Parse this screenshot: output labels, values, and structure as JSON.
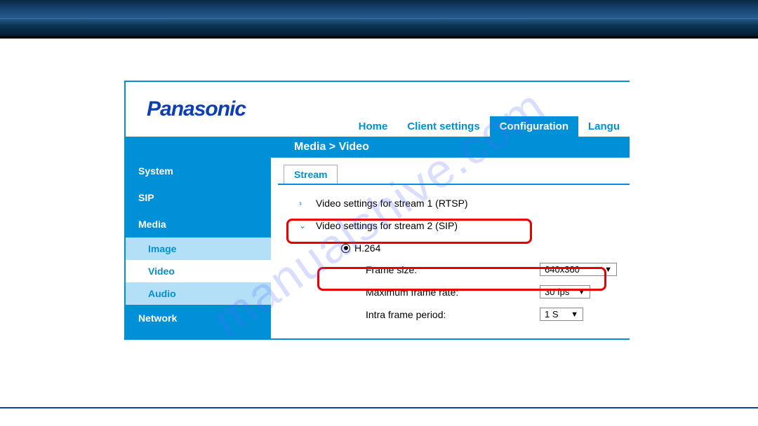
{
  "watermark": "manualshive.com",
  "brand": "Panasonic",
  "topnav": {
    "home": "Home",
    "client": "Client settings",
    "config": "Configuration",
    "lang": "Langu"
  },
  "breadcrumb": "Media  > Video",
  "sidebar": {
    "system": "System",
    "sip": "SIP",
    "media": "Media",
    "image": "Image",
    "video": "Video",
    "audio": "Audio",
    "network": "Network"
  },
  "tab": {
    "stream": "Stream"
  },
  "streams": {
    "s1": "Video settings for stream 1 (RTSP)",
    "s2": "Video settings for stream 2 (SIP)"
  },
  "codec": {
    "h264": "H.264"
  },
  "params": {
    "framesize_label": "Frame size:",
    "framesize_value": "640x360",
    "maxrate_label": "Maximum frame rate:",
    "maxrate_value": "30 fps",
    "intra_label": "Intra frame period:",
    "intra_value": "1 S"
  }
}
